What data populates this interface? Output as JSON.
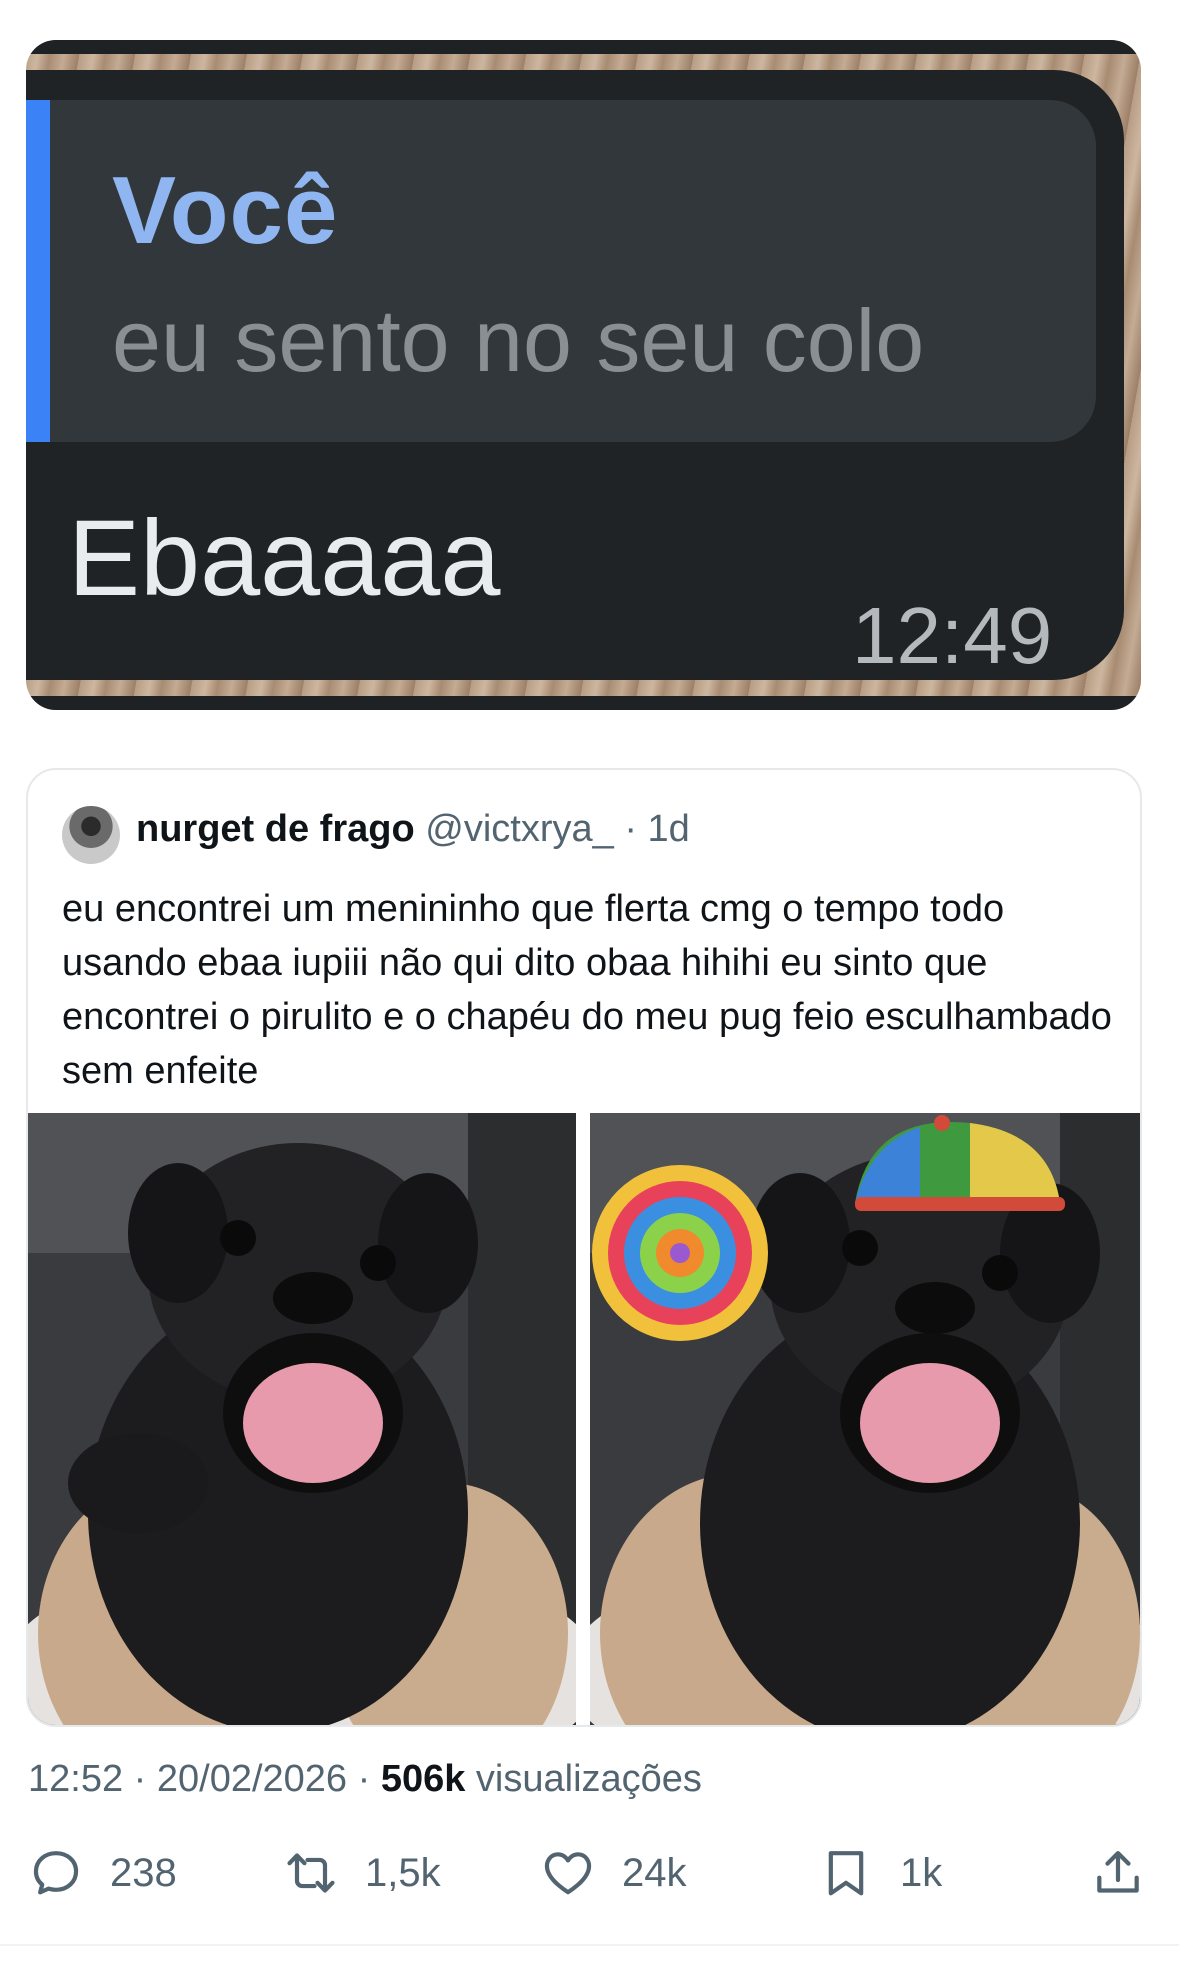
{
  "chat_screenshot": {
    "quoted_author": "Você",
    "quoted_message": "eu sento no seu colo",
    "reply_message": "Ebaaaaa",
    "time": "12:49"
  },
  "quoted_tweet": {
    "display_name": "nurget de frago",
    "handle": "@victxrya_",
    "age": "· 1d",
    "text": "eu encontrei um menininho que flerta cmg o tempo todo usando ebaa iupiii não qui dito obaa hihihi eu sinto que encontrei o pirulito e o chapéu do meu pug feio esculhambado sem enfeite"
  },
  "post_meta": {
    "time_date": "12:52 · 20/02/2026 · ",
    "views_count": "506k",
    "views_label": " visualizações"
  },
  "actions": {
    "replies": "238",
    "reposts": "1,5k",
    "likes": "24k",
    "bookmarks": "1k"
  },
  "colors": {
    "accent_quote_bar": "#3b82f6",
    "quote_author": "#8fb6f0",
    "secondary_text": "#536471"
  },
  "icons": [
    "reply-icon",
    "repost-icon",
    "like-icon",
    "bookmark-icon",
    "share-icon"
  ]
}
